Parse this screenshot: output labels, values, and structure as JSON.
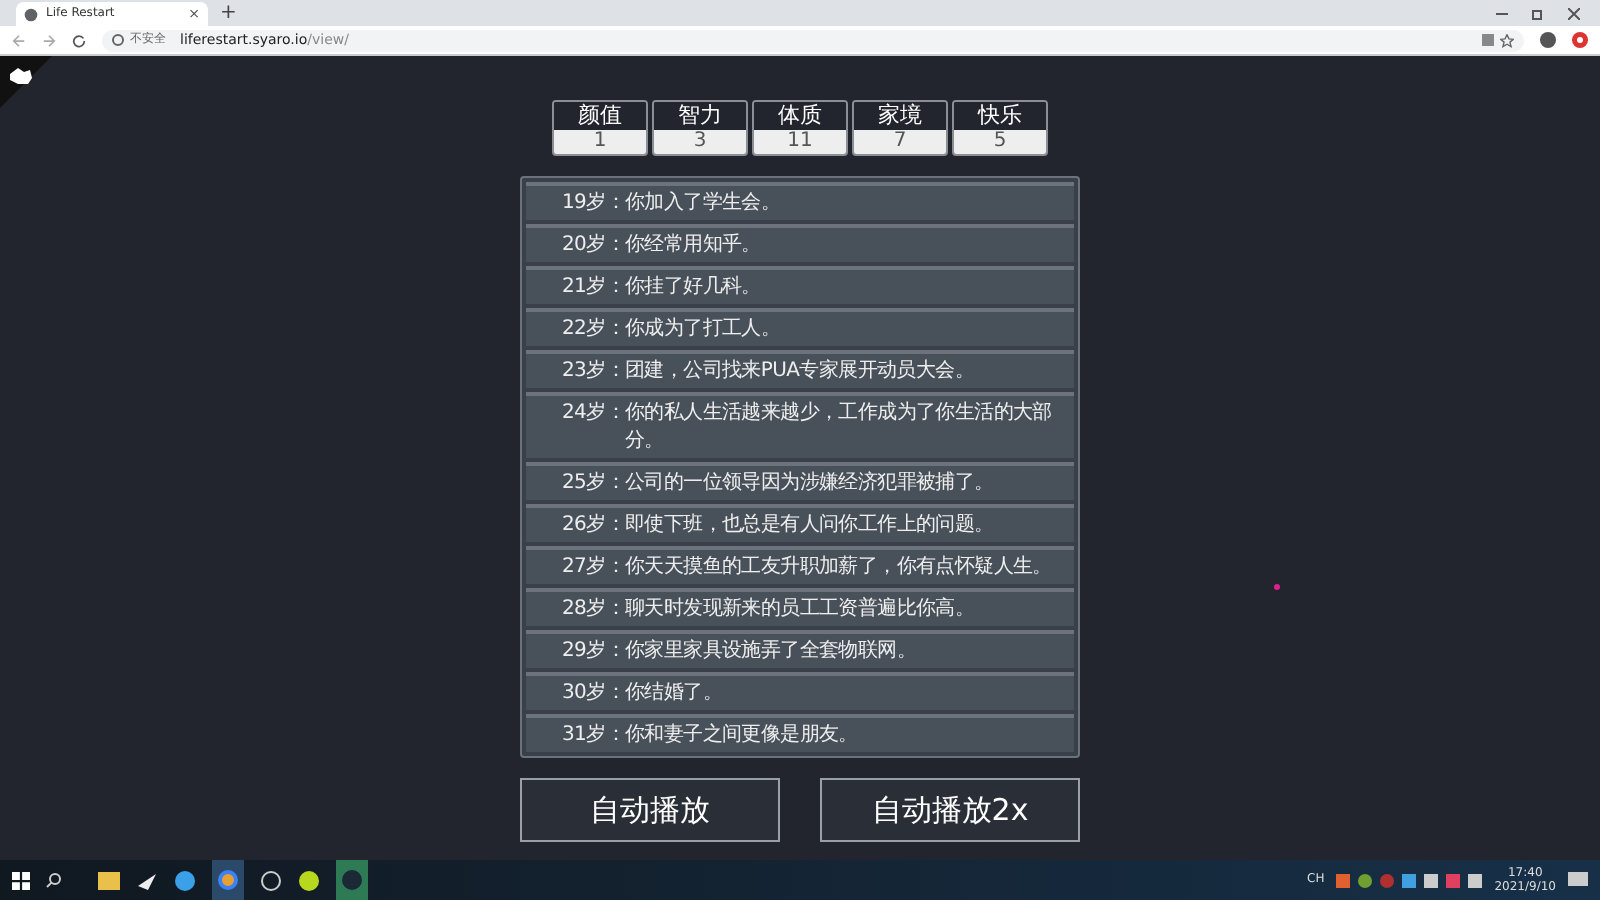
{
  "browser": {
    "tab": {
      "title": "Life Restart",
      "close": "×"
    },
    "new_tab": "+",
    "security": "不安全",
    "url_host": "liferestart.syaro.io",
    "url_path": "/view/"
  },
  "stats": [
    {
      "label": "颜值",
      "value": "1"
    },
    {
      "label": "智力",
      "value": "3"
    },
    {
      "label": "体质",
      "value": "11"
    },
    {
      "label": "家境",
      "value": "7"
    },
    {
      "label": "快乐",
      "value": "5"
    }
  ],
  "events": [
    {
      "age": "19岁：",
      "text": "你加入了学生会。"
    },
    {
      "age": "20岁：",
      "text": "你经常用知乎。"
    },
    {
      "age": "21岁：",
      "text": "你挂了好几科。"
    },
    {
      "age": "22岁：",
      "text": "你成为了打工人。"
    },
    {
      "age": "23岁：",
      "text": "团建，公司找来PUA专家展开动员大会。"
    },
    {
      "age": "24岁：",
      "text": "你的私人生活越来越少，工作成为了你生活的大部分。"
    },
    {
      "age": "25岁：",
      "text": "公司的一位领导因为涉嫌经济犯罪被捕了。"
    },
    {
      "age": "26岁：",
      "text": "即使下班，也总是有人问你工作上的问题。"
    },
    {
      "age": "27岁：",
      "text": "你天天摸鱼的工友升职加薪了，你有点怀疑人生。"
    },
    {
      "age": "28岁：",
      "text": "聊天时发现新来的员工工资普遍比你高。"
    },
    {
      "age": "29岁：",
      "text": "你家里家具设施弄了全套物联网。"
    },
    {
      "age": "30岁：",
      "text": "你结婚了。"
    },
    {
      "age": "31岁：",
      "text": "你和妻子之间更像是朋友。"
    }
  ],
  "buttons": [
    "自动播放",
    "自动播放2x"
  ],
  "taskbar": {
    "tray_language": "CH",
    "time": "17:40",
    "date": "2021/9/10"
  }
}
